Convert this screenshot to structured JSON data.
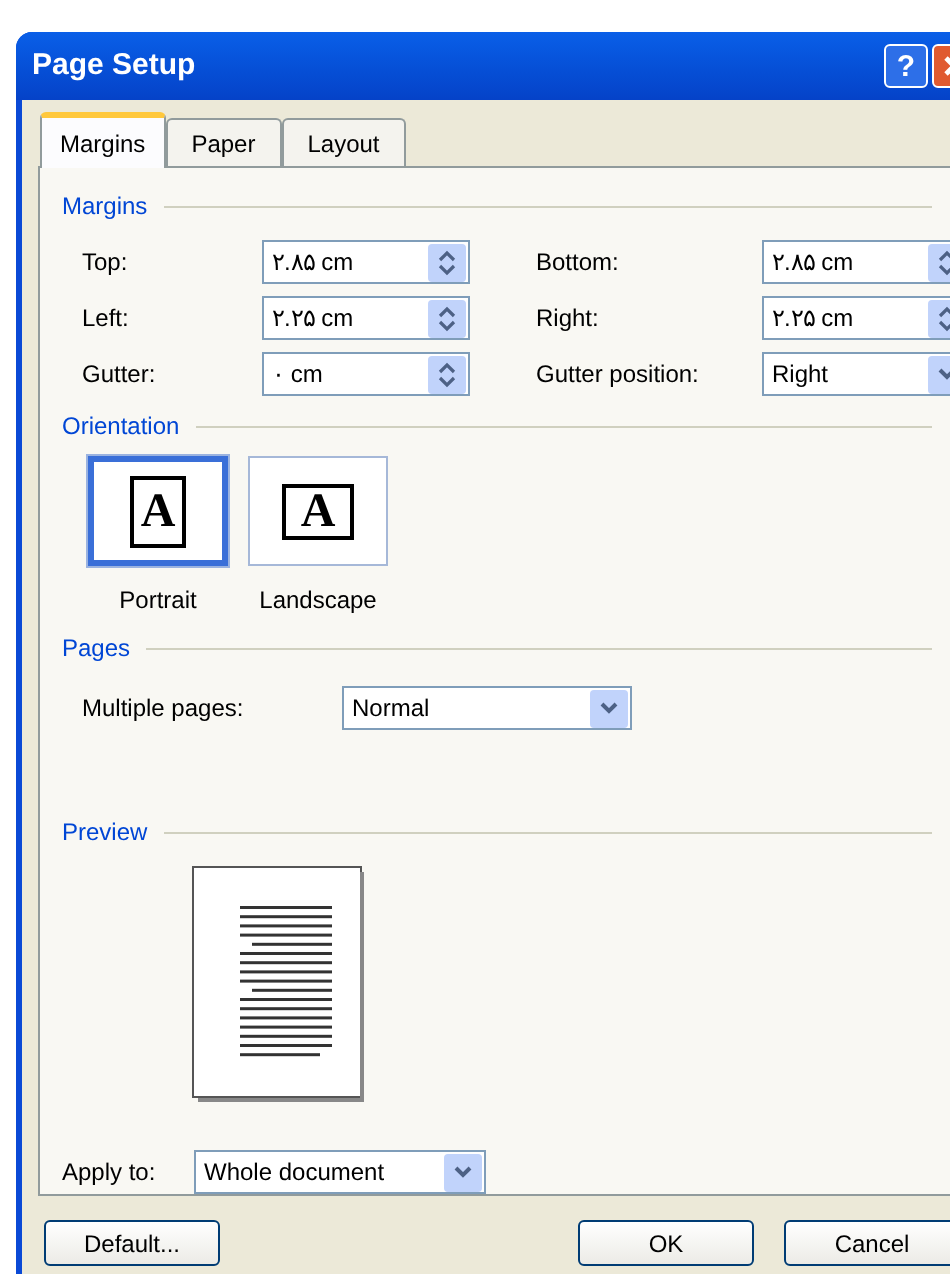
{
  "window": {
    "title": "Page Setup",
    "help_glyph": "?"
  },
  "tabs": [
    {
      "label": "Margins",
      "selected": true
    },
    {
      "label": "Paper",
      "selected": false
    },
    {
      "label": "Layout",
      "selected": false
    }
  ],
  "margins": {
    "heading": "Margins",
    "fields": [
      {
        "kind": "spin",
        "label": "Top:",
        "value": "۲.۸۵ cm"
      },
      {
        "kind": "spin",
        "label": "Bottom:",
        "value": "۲.۸۵ cm"
      },
      {
        "kind": "spin",
        "label": "Left:",
        "value": "۲.۲۵ cm"
      },
      {
        "kind": "spin",
        "label": "Right:",
        "value": "۲.۲۵ cm"
      },
      {
        "kind": "spin",
        "label": "Gutter:",
        "value": "۰ cm"
      },
      {
        "kind": "select",
        "label": "Gutter position:",
        "value": "Right"
      }
    ]
  },
  "orientation": {
    "heading": "Orientation",
    "options": [
      {
        "label": "Portrait",
        "glyph": "A",
        "selected": true
      },
      {
        "label": "Landscape",
        "glyph": "A",
        "selected": false
      }
    ]
  },
  "pages": {
    "heading": "Pages",
    "label": "Multiple pages:",
    "value": "Normal"
  },
  "preview": {
    "heading": "Preview"
  },
  "apply_to": {
    "label": "Apply to:",
    "value": "Whole document"
  },
  "buttons": [
    {
      "label": "Default...",
      "kind": "left"
    },
    {
      "label": "OK",
      "kind": "right"
    },
    {
      "label": "Cancel",
      "kind": "right"
    }
  ]
}
